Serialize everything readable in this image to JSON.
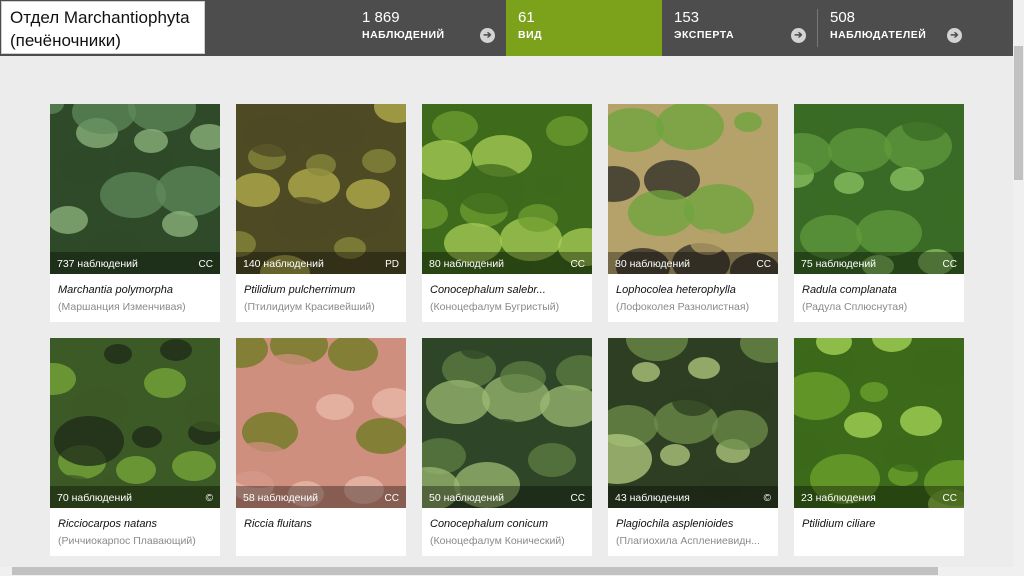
{
  "header": {
    "title_line1": "Отдел Marchantiophyta",
    "title_line2": "(печёночники)",
    "accent_color": "#7ca21c",
    "stats": [
      {
        "num": "1 869",
        "label": "наблюдений",
        "active": false
      },
      {
        "num": "61",
        "label": "вид",
        "active": true
      },
      {
        "num": "153",
        "label": "эксперта",
        "active": false
      },
      {
        "num": "508",
        "label": "наблюдателей",
        "active": false
      }
    ],
    "arrow_icon": "arrow-right-circle-icon",
    "arrow_glyph": "➔"
  },
  "species": [
    {
      "obs": "737 наблюдений",
      "license": "CC",
      "sci": "Marchantia polymorpha",
      "common": "(Маршанция Изменчивая)",
      "palette": [
        "#5f8a5a",
        "#8fb77f",
        "#2f4a28"
      ]
    },
    {
      "obs": "140 наблюдений",
      "license": "PD",
      "sci": "Ptilidium pulcherrimum",
      "common": "(Птилидиум Красивейший)",
      "palette": [
        "#8b8a3c",
        "#b6b14e",
        "#4e4a24"
      ]
    },
    {
      "obs": "80 наблюдений",
      "license": "CC",
      "sci": "Conocephalum salebr...",
      "common": "(Коноцефалум Бугристый)",
      "palette": [
        "#6f9e2f",
        "#a9cf55",
        "#3e6a1c"
      ]
    },
    {
      "obs": "80 наблюдений",
      "license": "CC",
      "sci": "Lophocolea heterophylla",
      "common": "(Лофоколея Разнолистная)",
      "palette": [
        "#2b2a26",
        "#6ea43c",
        "#b5a26a"
      ]
    },
    {
      "obs": "75 наблюдений",
      "license": "CC",
      "sci": "Radula complanata",
      "common": "(Радула Сплюснутая)",
      "palette": [
        "#5f9a3c",
        "#8cc463",
        "#3a6b26"
      ]
    },
    {
      "obs": "70 наблюдений",
      "license": "©",
      "sci": "Ricciocarpos natans",
      "common": "(Риччиокарпос Плавающий)",
      "palette": [
        "#1d2a1a",
        "#79a93a",
        "#3c5a25"
      ]
    },
    {
      "obs": "58 наблюдений",
      "license": "CC",
      "sci": "Riccia fluitans",
      "common": "",
      "palette": [
        "#e9b9a9",
        "#6a7a1e",
        "#cf8f7f"
      ]
    },
    {
      "obs": "50 наблюдений",
      "license": "CC",
      "sci": "Conocephalum conicum",
      "common": "(Коноцефалум Конический)",
      "palette": [
        "#5d7f43",
        "#9cba73",
        "#2f4527"
      ]
    },
    {
      "obs": "43 наблюдения",
      "license": "©",
      "sci": "Plagiochila asplenioides",
      "common": "(Плагиохила Асплениевидн...",
      "palette": [
        "#6d8e4a",
        "#b3cc82",
        "#2e3e22"
      ]
    },
    {
      "obs": "23 наблюдения",
      "license": "CC",
      "sci": "Ptilidium ciliare",
      "common": "",
      "palette": [
        "#6ea42e",
        "#a8d858",
        "#3c6a1a"
      ]
    }
  ]
}
